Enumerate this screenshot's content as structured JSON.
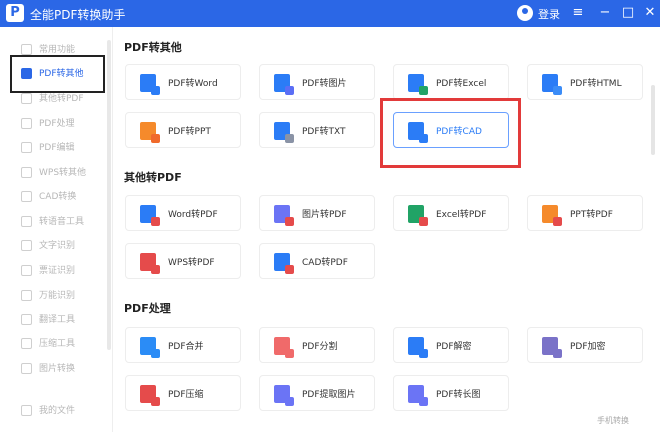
{
  "app": {
    "logo": "P",
    "title": "全能PDF转换助手",
    "login": "登录"
  },
  "window_controls": {
    "menu": "≡",
    "minimize": "−",
    "maximize": "□",
    "close": "✕"
  },
  "sidebar": {
    "items": [
      {
        "label": "常用功能"
      },
      {
        "label": "PDF转其他",
        "active": true
      },
      {
        "label": "其他转PDF"
      },
      {
        "label": "PDF处理"
      },
      {
        "label": "PDF编辑"
      },
      {
        "label": "WPS转其他"
      },
      {
        "label": "CAD转换"
      },
      {
        "label": "转语音工具"
      },
      {
        "label": "文字识别"
      },
      {
        "label": "票证识别"
      },
      {
        "label": "万能识别"
      },
      {
        "label": "翻译工具"
      },
      {
        "label": "压缩工具"
      },
      {
        "label": "图片转换"
      },
      {
        "label": "我的文件"
      }
    ]
  },
  "sections": {
    "pdf_to_other": {
      "title": "PDF转其他",
      "cards": [
        {
          "label": "PDF转Word",
          "color": "#2b7cf6",
          "mini": "#2b7cf6"
        },
        {
          "label": "PDF转图片",
          "color": "#2b7cf6",
          "mini": "#5b6ef5"
        },
        {
          "label": "PDF转Excel",
          "color": "#2b7cf6",
          "mini": "#21a366"
        },
        {
          "label": "PDF转HTML",
          "color": "#2b7cf6",
          "mini": "#3b8cf7"
        },
        {
          "label": "PDF转PPT",
          "color": "#f58a2b",
          "mini": "#f06a2b"
        },
        {
          "label": "PDF转TXT",
          "color": "#2b7cf6",
          "mini": "#8a93a6"
        },
        {
          "label": "PDF转CAD",
          "color": "#2b7cf6",
          "mini": "#2b7cf6"
        }
      ]
    },
    "other_to_pdf": {
      "title": "其他转PDF",
      "cards": [
        {
          "label": "Word转PDF",
          "color": "#2b7cf6",
          "mini": "#e54b4b"
        },
        {
          "label": "图片转PDF",
          "color": "#6b74f5",
          "mini": "#e54b4b"
        },
        {
          "label": "Excel转PDF",
          "color": "#21a366",
          "mini": "#e54b4b"
        },
        {
          "label": "PPT转PDF",
          "color": "#f58a2b",
          "mini": "#e54b4b"
        },
        {
          "label": "WPS转PDF",
          "color": "#e54b4b",
          "mini": "#e54b4b"
        },
        {
          "label": "CAD转PDF",
          "color": "#2b7cf6",
          "mini": "#e54b4b"
        }
      ]
    },
    "pdf_process": {
      "title": "PDF处理",
      "cards": [
        {
          "label": "PDF合并",
          "color": "#2b8cf6",
          "mini": "#2b8cf6"
        },
        {
          "label": "PDF分割",
          "color": "#f06a6a",
          "mini": "#f06a6a"
        },
        {
          "label": "PDF解密",
          "color": "#2b7cf6",
          "mini": "#2b7cf6"
        },
        {
          "label": "PDF加密",
          "color": "#7a72c8",
          "mini": "#7a72c8"
        },
        {
          "label": "PDF压缩",
          "color": "#e54b4b",
          "mini": "#e54b4b"
        },
        {
          "label": "PDF提取图片",
          "color": "#6b74f5",
          "mini": "#6b74f5"
        },
        {
          "label": "PDF转长图",
          "color": "#6b74f5",
          "mini": "#6b74f5"
        }
      ]
    }
  },
  "footer": "手机转换"
}
